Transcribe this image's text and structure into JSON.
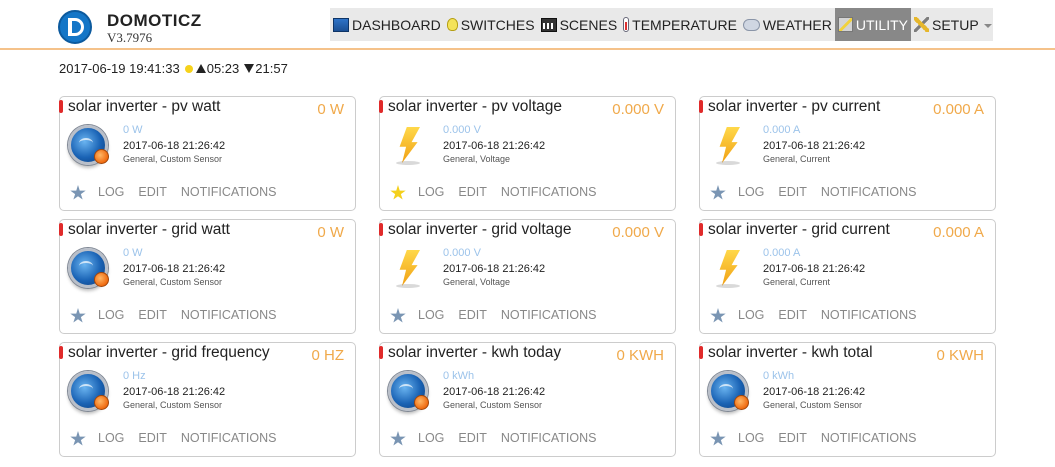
{
  "app": {
    "name": "DOMOTICZ",
    "version": "V3.7976"
  },
  "nav": [
    {
      "label": "DASHBOARD",
      "icon": "dashboard-icon",
      "active": false
    },
    {
      "label": "SWITCHES",
      "icon": "lightbulb-icon",
      "active": false
    },
    {
      "label": "SCENES",
      "icon": "clapperboard-icon",
      "active": false
    },
    {
      "label": "TEMPERATURE",
      "icon": "thermometer-icon",
      "active": false
    },
    {
      "label": "WEATHER",
      "icon": "weather-cloud-icon",
      "active": false
    },
    {
      "label": "UTILITY",
      "icon": "utility-icon",
      "active": true
    },
    {
      "label": "SETUP",
      "icon": "tools-icon",
      "active": false
    }
  ],
  "status": {
    "datetime": "2017-06-19 19:41:33",
    "sunrise": "05:23",
    "sunset": "21:57"
  },
  "card_actions": {
    "log": "LOG",
    "edit": "EDIT",
    "notifications": "NOTIFICATIONS"
  },
  "colors": {
    "accent": "#f0a94a",
    "subvalue": "#9cc3ea",
    "marker": "#e02a2a",
    "active_nav": "#888888"
  },
  "devices": [
    {
      "name": "solar inverter - pv watt",
      "value": "0 W",
      "subvalue": "0 W",
      "lastupdate": "2017-06-18 21:26:42",
      "type": "General, Custom Sensor",
      "icon": "custom-sensor-icon",
      "favorite": false
    },
    {
      "name": "solar inverter - pv voltage",
      "value": "0.000 V",
      "subvalue": "0.000 V",
      "lastupdate": "2017-06-18 21:26:42",
      "type": "General, Voltage",
      "icon": "lightning-bolt-icon",
      "favorite": true
    },
    {
      "name": "solar inverter - pv current",
      "value": "0.000 A",
      "subvalue": "0.000 A",
      "lastupdate": "2017-06-18 21:26:42",
      "type": "General, Current",
      "icon": "lightning-bolt-icon",
      "favorite": false
    },
    {
      "name": "solar inverter - grid watt",
      "value": "0 W",
      "subvalue": "0 W",
      "lastupdate": "2017-06-18 21:26:42",
      "type": "General, Custom Sensor",
      "icon": "custom-sensor-icon",
      "favorite": false
    },
    {
      "name": "solar inverter - grid voltage",
      "value": "0.000 V",
      "subvalue": "0.000 V",
      "lastupdate": "2017-06-18 21:26:42",
      "type": "General, Voltage",
      "icon": "lightning-bolt-icon",
      "favorite": false
    },
    {
      "name": "solar inverter - grid current",
      "value": "0.000 A",
      "subvalue": "0.000 A",
      "lastupdate": "2017-06-18 21:26:42",
      "type": "General, Current",
      "icon": "lightning-bolt-icon",
      "favorite": false
    },
    {
      "name": "solar inverter - grid frequency",
      "value": "0 HZ",
      "subvalue": "0 Hz",
      "lastupdate": "2017-06-18 21:26:42",
      "type": "General, Custom Sensor",
      "icon": "custom-sensor-icon",
      "favorite": false
    },
    {
      "name": "solar inverter - kwh today",
      "value": "0 KWH",
      "subvalue": "0 kWh",
      "lastupdate": "2017-06-18 21:26:42",
      "type": "General, Custom Sensor",
      "icon": "custom-sensor-icon",
      "favorite": false
    },
    {
      "name": "solar inverter - kwh total",
      "value": "0 KWH",
      "subvalue": "0 kWh",
      "lastupdate": "2017-06-18 21:26:42",
      "type": "General, Custom Sensor",
      "icon": "custom-sensor-icon",
      "favorite": false
    }
  ]
}
